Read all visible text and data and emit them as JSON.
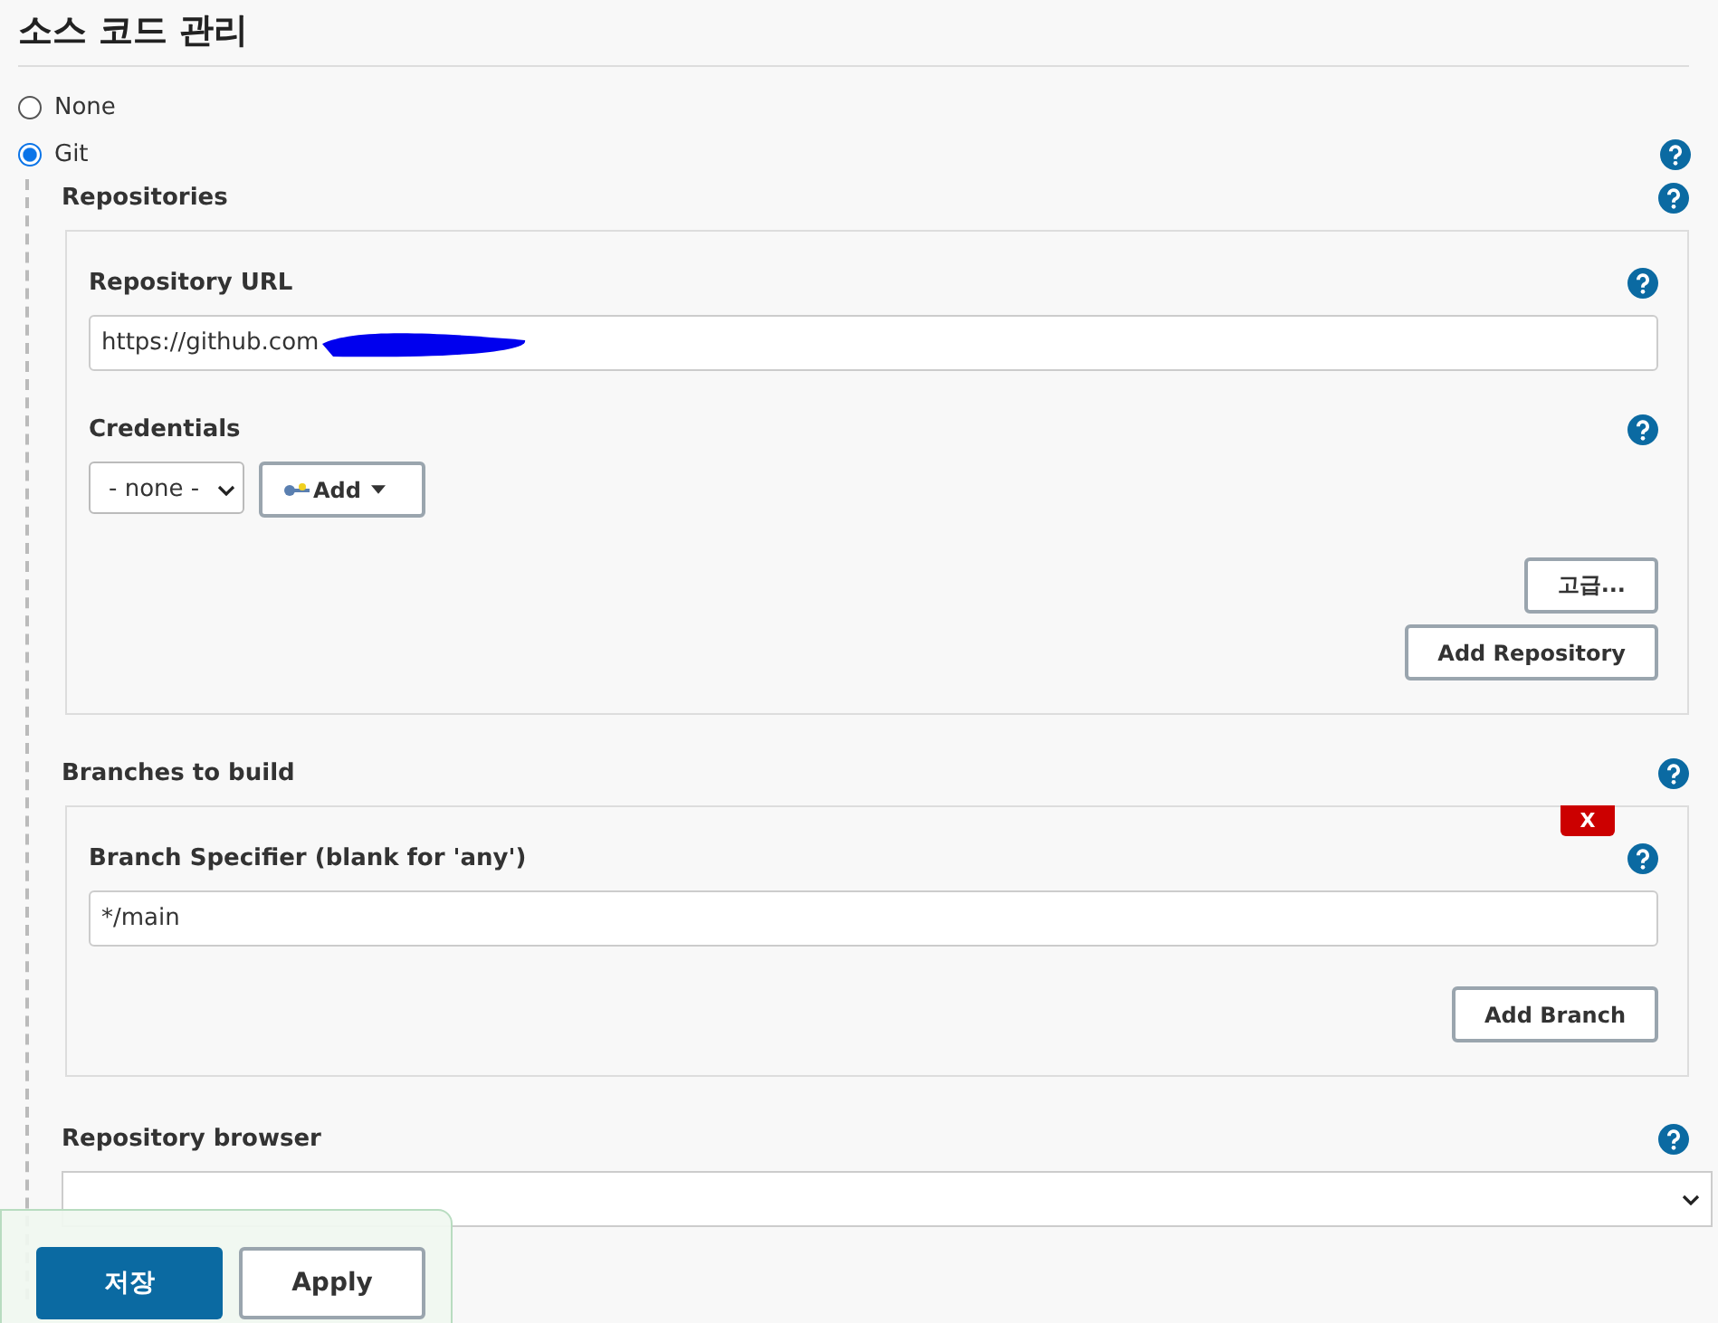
{
  "section_title": "소스 코드 관리",
  "scm_options": [
    {
      "label": "None",
      "selected": false
    },
    {
      "label": "Git",
      "selected": true
    }
  ],
  "repositories": {
    "label": "Repositories",
    "url_label": "Repository URL",
    "url_value": "https://github.com",
    "credentials_label": "Credentials",
    "credentials_value": "- none -",
    "add_button": "Add",
    "advanced_button": "고급...",
    "add_repository_button": "Add Repository"
  },
  "branches": {
    "label": "Branches to build",
    "delete_button": "X",
    "specifier_label": "Branch Specifier (blank for 'any')",
    "specifier_value": "*/main",
    "add_branch_button": "Add Branch"
  },
  "repository_browser": {
    "label": "Repository browser"
  },
  "footer_buttons": [
    {
      "label": "저장",
      "kind": "primary"
    },
    {
      "label": "Apply",
      "kind": "secondary"
    }
  ]
}
